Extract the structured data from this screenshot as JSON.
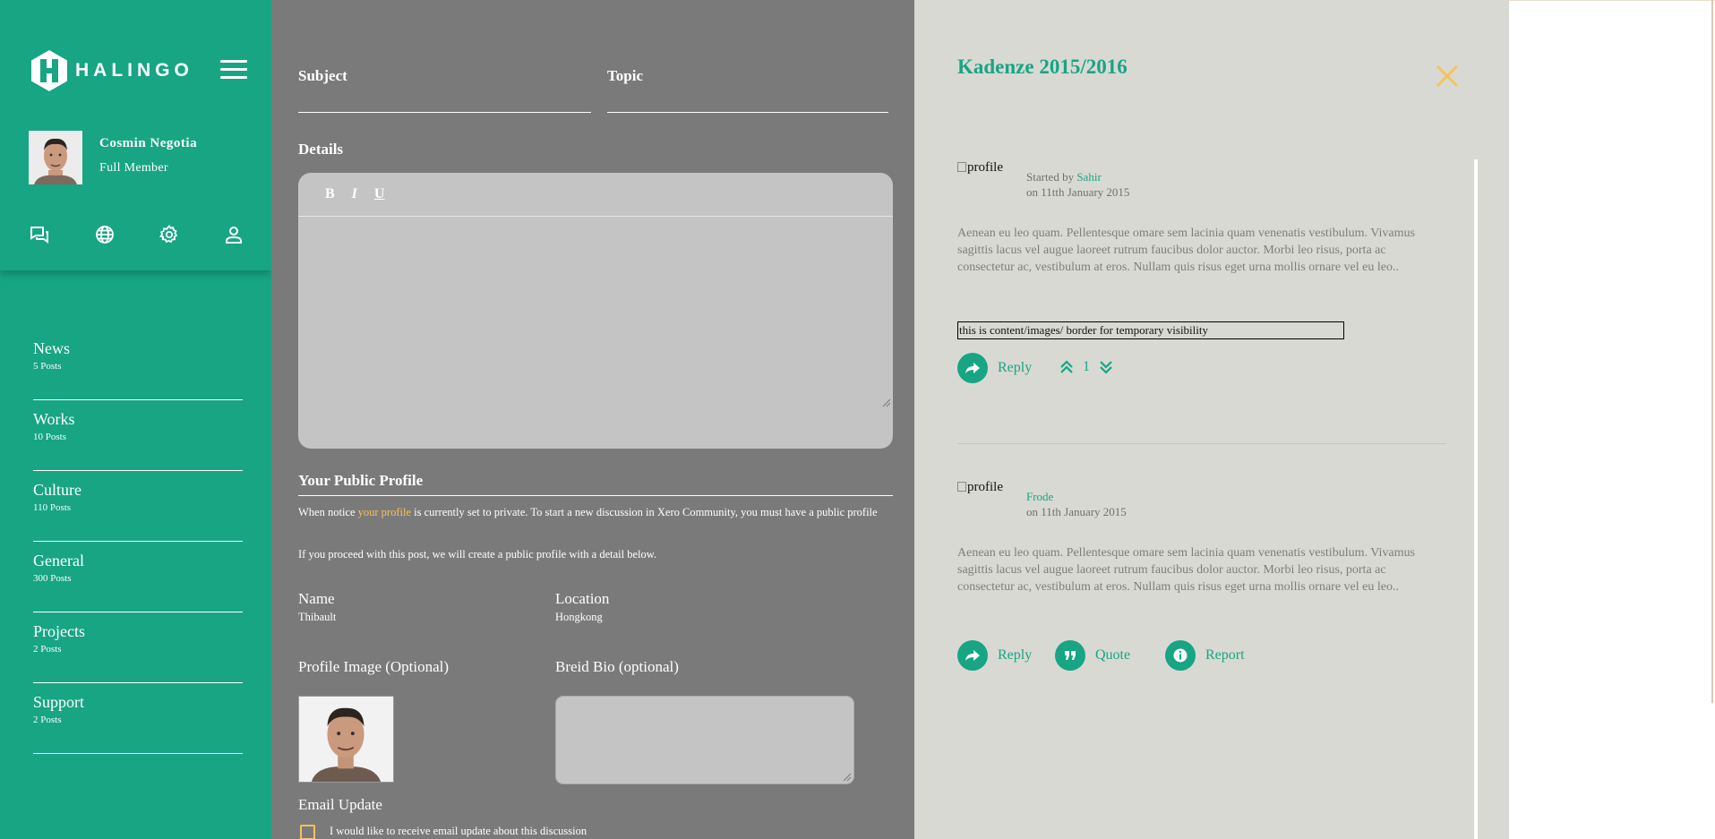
{
  "app": {
    "logo_text": "HALINGO"
  },
  "user": {
    "name": "Cosmin Negotia",
    "role": "Full Member"
  },
  "quick_icons": [
    "chat-icon",
    "globe-icon",
    "gear-icon",
    "user-icon"
  ],
  "nav": [
    {
      "label": "News",
      "count": "5 Posts"
    },
    {
      "label": "Works",
      "count": "10 Posts"
    },
    {
      "label": "Culture",
      "count": "110 Posts"
    },
    {
      "label": "General",
      "count": "300 Posts"
    },
    {
      "label": "Projects",
      "count": "2 Posts"
    },
    {
      "label": "Support",
      "count": "2 Posts"
    }
  ],
  "form": {
    "subject_label": "Subject",
    "topic_label": "Topic",
    "details_label": "Details",
    "toolbar": {
      "bold": "B",
      "italic": "I",
      "underline": "U"
    },
    "public_profile_title": "Your Public Profile",
    "notice_before": "When notice ",
    "notice_link": "your profile",
    "notice_after": " is currently set to private. To start a new discussion in Xero Community, you must have a public profile",
    "notice2": "If you proceed with this post, we will create a public profile with a detail below.",
    "name_label": "Name",
    "name_value": "Thibault",
    "location_label": "Location",
    "location_value": "Hongkong",
    "profile_image_label": "Profile Image (Optional)",
    "bio_label": "Breid Bio (optional)",
    "email_update_label": "Email Update",
    "email_checkbox_label": "I would like to receive email update about this discussion"
  },
  "thread": {
    "title": "Kadenze 2015/2016",
    "posts": [
      {
        "img_alt": "profile",
        "started_by_prefix": "Started by ",
        "author": "Sahir",
        "date": "on 11tth January 2015",
        "body": "Aenean eu leo quam. Pellentesque omare sem lacinia quam venenatis vestibulum. Vivamus sagittis lacus vel augue laoreet rutrum faucibus dolor auctor. Morbi leo risus, porta ac consectetur ac, vestibulum at eros. Nullam quis risus eget urna mollis ornare vel eu leo..",
        "temp_note": "this is content/images/ border for temporary visibility",
        "reply_label": "Reply",
        "votes": "1"
      },
      {
        "img_alt": "profile",
        "author": "Frode",
        "date": "on 11th January 2015",
        "body": "Aenean eu leo quam. Pellentesque omare sem lacinia quam venenatis vestibulum. Vivamus sagittis lacus vel augue laoreet rutrum faucibus dolor auctor. Morbi leo risus, porta ac consectetur ac, vestibulum at eros. Nullam quis risus eget urna mollis ornare vel eu leo..",
        "reply_label": "Reply",
        "quote_label": "Quote",
        "report_label": "Report"
      }
    ]
  },
  "colors": {
    "brand": "#17a584",
    "accent": "#f5c35a",
    "form_bg": "#7a7a7a",
    "thread_bg": "#d9d9d4"
  }
}
